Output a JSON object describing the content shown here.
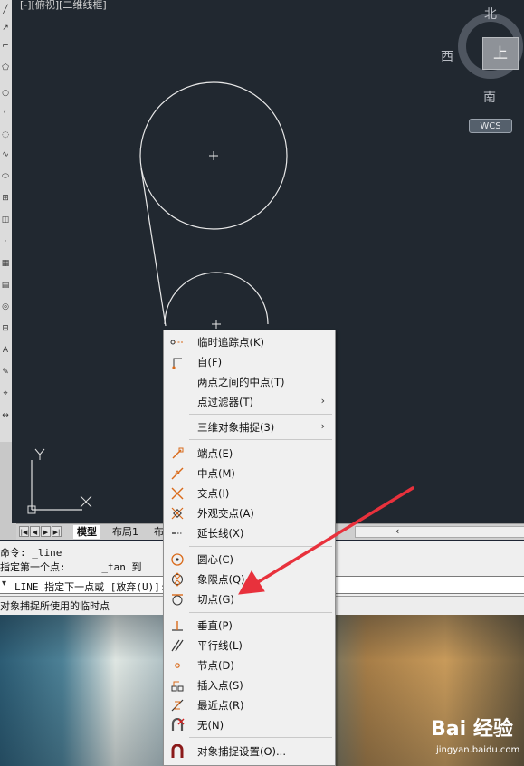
{
  "viewport": {
    "label": "[-][俯视][二维线框]"
  },
  "viewcube": {
    "north": "北",
    "south": "南",
    "west": "西",
    "face": "上",
    "wcs": "WCS"
  },
  "tabs": {
    "items": [
      "模型",
      "布局1",
      "布"
    ]
  },
  "command": {
    "line1": "命令: _line",
    "line2": "指定第一个点:      _tan 到",
    "prompt": "LINE 指定下一点或 [放弃(U)]:"
  },
  "status": {
    "text": "对象捕捉所使用的临时点"
  },
  "context_menu": {
    "items": [
      {
        "label": "临时追踪点(K)",
        "icon": "temporary-track-icon"
      },
      {
        "label": "自(F)",
        "icon": "from-icon"
      },
      {
        "label": "两点之间的中点(T)",
        "icon": ""
      },
      {
        "label": "点过滤器(T)",
        "icon": "",
        "submenu": true
      },
      {
        "label": "三维对象捕捉(3)",
        "icon": "",
        "submenu": true
      },
      {
        "label": "端点(E)",
        "icon": "endpoint-icon"
      },
      {
        "label": "中点(M)",
        "icon": "midpoint-icon"
      },
      {
        "label": "交点(I)",
        "icon": "intersection-icon"
      },
      {
        "label": "外观交点(A)",
        "icon": "apparent-intersection-icon"
      },
      {
        "label": "延长线(X)",
        "icon": "extension-icon"
      },
      {
        "label": "圆心(C)",
        "icon": "center-icon"
      },
      {
        "label": "象限点(Q)",
        "icon": "quadrant-icon"
      },
      {
        "label": "切点(G)",
        "icon": "tangent-icon"
      },
      {
        "label": "垂直(P)",
        "icon": "perpendicular-icon"
      },
      {
        "label": "平行线(L)",
        "icon": "parallel-icon"
      },
      {
        "label": "节点(D)",
        "icon": "node-icon"
      },
      {
        "label": "插入点(S)",
        "icon": "insertion-icon"
      },
      {
        "label": "最近点(R)",
        "icon": "nearest-icon"
      },
      {
        "label": "无(N)",
        "icon": "none-icon"
      },
      {
        "label": "对象捕捉设置(O)...",
        "icon": "osnap-settings-icon"
      }
    ]
  },
  "watermark": {
    "brand": "Bai 经验",
    "url": "jingyan.baidu.com"
  },
  "colors": {
    "canvas": "#212830",
    "menu_bg": "#f0f0f0",
    "arrow": "#e8313c",
    "icon_orange": "#d96a1a"
  }
}
